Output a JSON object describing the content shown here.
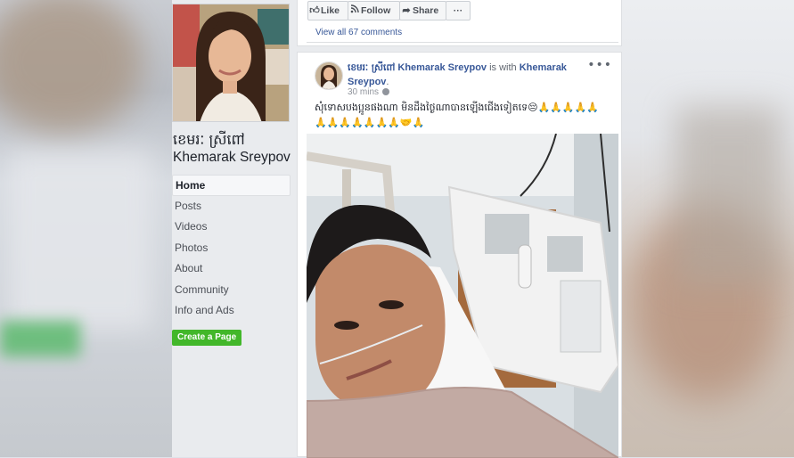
{
  "page": {
    "name_km": "ខេមរៈ ស្រីពៅ",
    "name_en": "Khemarak Sreypov"
  },
  "nav": {
    "items": [
      {
        "label": "Home",
        "active": true
      },
      {
        "label": "Posts"
      },
      {
        "label": "Videos"
      },
      {
        "label": "Photos"
      },
      {
        "label": "About"
      },
      {
        "label": "Community"
      },
      {
        "label": "Info and Ads"
      }
    ],
    "create_page_label": "Create a Page"
  },
  "actions": {
    "like_label": "Like",
    "follow_label": "Follow",
    "share_label": "Share",
    "more_label": "···",
    "view_comments": "View all 67 comments"
  },
  "post": {
    "author_km": "ខេមរៈ ស្រីពៅ",
    "author_en": "Khemarak Sreypov",
    "with_text": "is with",
    "tagged": "Khemarak Sreypov",
    "time": "30 mins",
    "text": "សុំទោសបងប្អូនផងណា មិនដឹងថ្ងៃណាបានឡើងជើងទៀតទេ😔🙏🙏🙏🙏🙏🙏🙏🙏🙏🙏🙏🙏🤝🙏"
  },
  "colors": {
    "link": "#385898",
    "create_button": "#42b72a",
    "feed_bg": "#e9ebee"
  }
}
